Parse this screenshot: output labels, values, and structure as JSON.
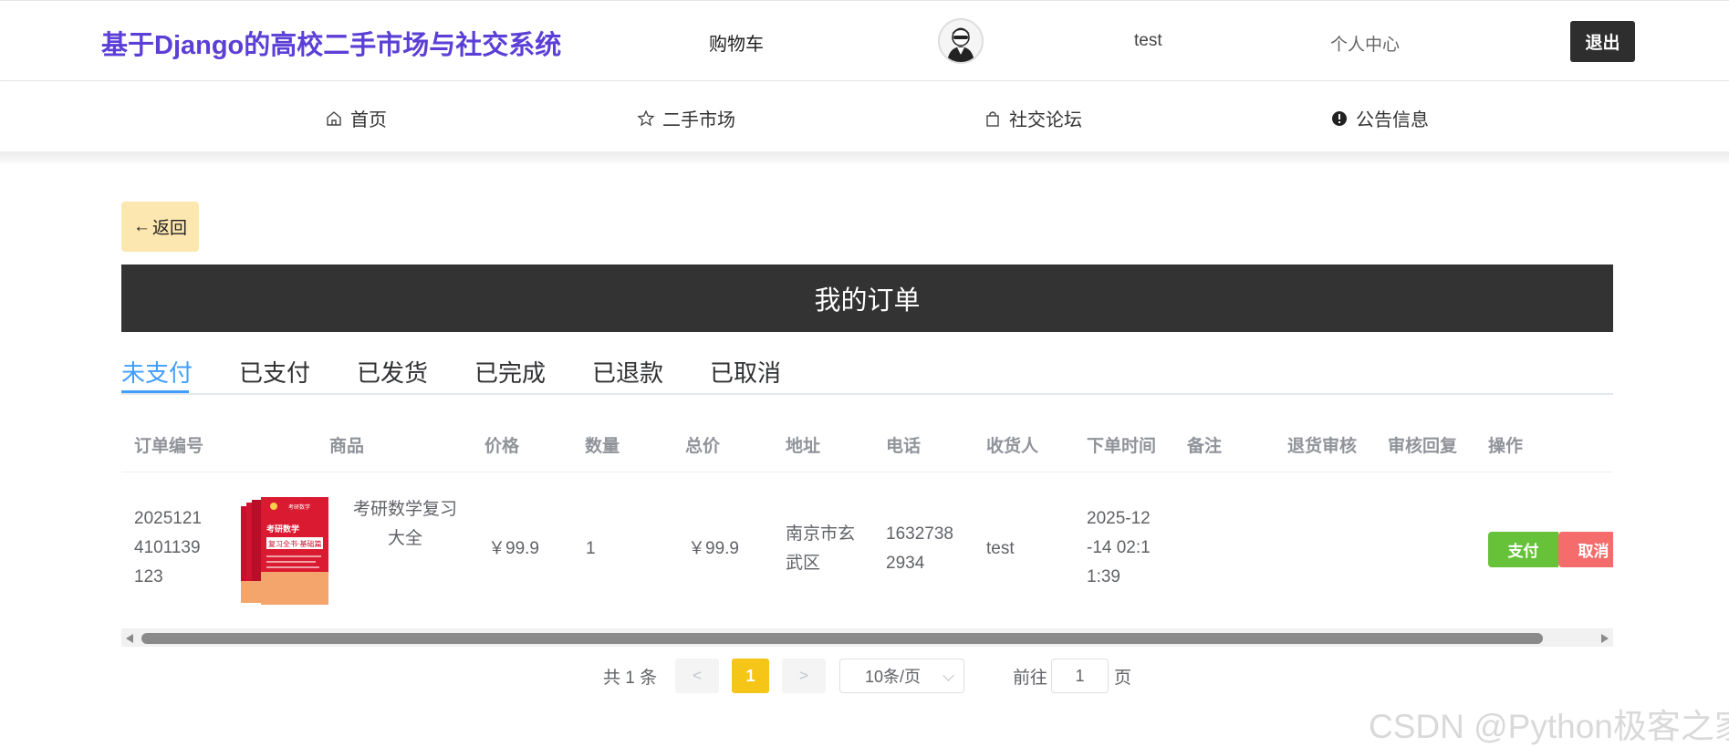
{
  "header": {
    "site_title": "基于Django的高校二手市场与社交系统",
    "cart_label": "购物车",
    "username": "test",
    "profile_label": "个人中心",
    "logout_label": "退出"
  },
  "nav": {
    "items": [
      {
        "label": "首页",
        "icon": "home-icon"
      },
      {
        "label": "二手市场",
        "icon": "star-icon"
      },
      {
        "label": "社交论坛",
        "icon": "bag-icon"
      },
      {
        "label": "公告信息",
        "icon": "info-icon"
      }
    ]
  },
  "back": {
    "arrow": "←",
    "label": "返回"
  },
  "banner": {
    "title": "我的订单"
  },
  "tabs": [
    {
      "label": "未支付",
      "active": true
    },
    {
      "label": "已支付"
    },
    {
      "label": "已发货"
    },
    {
      "label": "已完成"
    },
    {
      "label": "已退款"
    },
    {
      "label": "已取消"
    }
  ],
  "table": {
    "columns": [
      "订单编号",
      "商品",
      "价格",
      "数量",
      "总价",
      "地址",
      "电话",
      "收货人",
      "下单时间",
      "备注",
      "退货审核",
      "审核回复",
      "操作"
    ],
    "rows": [
      {
        "order_no_lines": [
          "2025121",
          "4101139",
          "123"
        ],
        "product_name_lines": [
          "考研数学复习",
          "大全"
        ],
        "price": "￥99.9",
        "quantity": "1",
        "total": "￥99.9",
        "address_lines": [
          "南京市玄",
          "武区"
        ],
        "phone_lines": [
          "1632738",
          "2934"
        ],
        "receiver": "test",
        "time_lines": [
          "2025-12",
          "-14 02:1",
          "1:39"
        ],
        "note": "",
        "return_review": "",
        "review_reply": "",
        "actions": {
          "pay": "支付",
          "cancel": "取消"
        }
      }
    ]
  },
  "pagination": {
    "total_text": "共 1 条",
    "prev": "<",
    "current_page": "1",
    "next": ">",
    "page_size": "10条/页",
    "goto_prefix": "前往",
    "goto_value": "1",
    "goto_suffix": "页"
  },
  "watermark": "CSDN @Python极客之家",
  "colors": {
    "title": "#5b3fd6",
    "banner": "#333333",
    "active_tab": "#409eff",
    "pay": "#67c23a",
    "cancel": "#f56c6c",
    "current_page": "#f5c518",
    "back_button": "#fde7b0"
  }
}
